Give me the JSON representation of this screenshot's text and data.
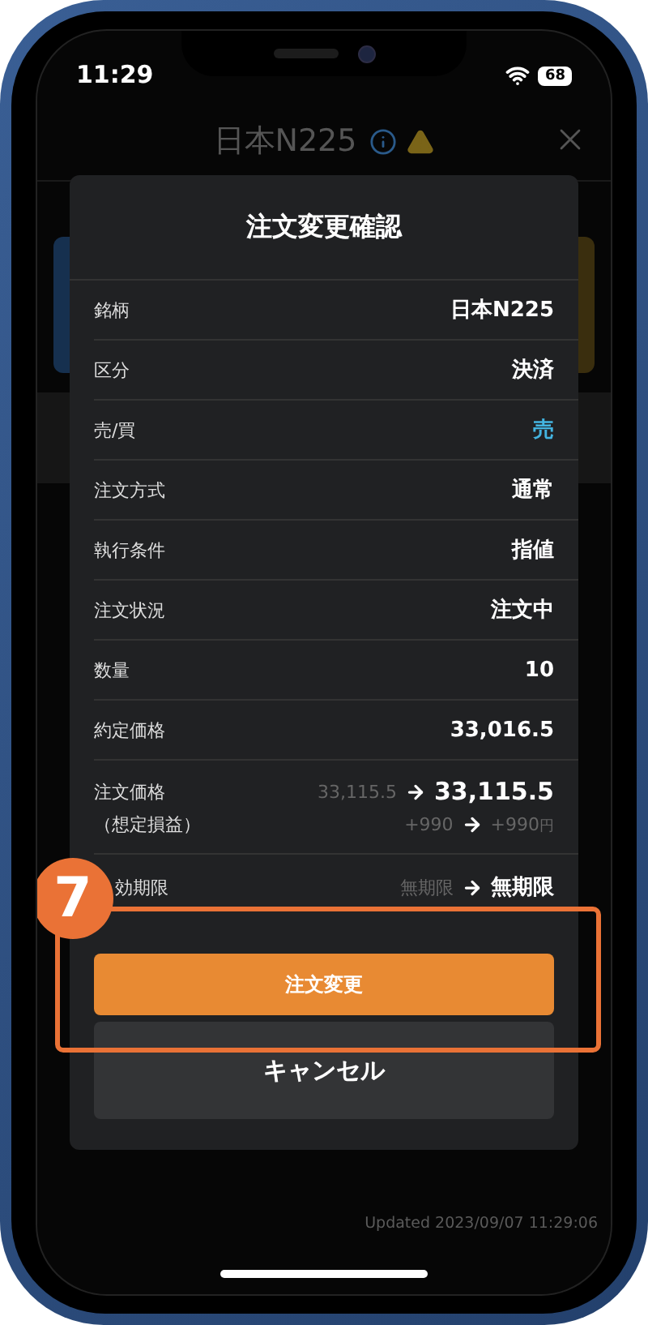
{
  "status_bar": {
    "time": "11:29",
    "battery": "68"
  },
  "header": {
    "title": "日本N225"
  },
  "dialog": {
    "title": "注文変更確認",
    "rows": [
      {
        "kind": "plain",
        "label": "銘柄",
        "value": "日本N225"
      },
      {
        "kind": "plain",
        "label": "区分",
        "value": "決済"
      },
      {
        "kind": "side",
        "label": "売/買",
        "value": "売"
      },
      {
        "kind": "plain",
        "label": "注文方式",
        "value": "通常"
      },
      {
        "kind": "plain",
        "label": "執行条件",
        "value": "指値"
      },
      {
        "kind": "plain",
        "label": "注文状況",
        "value": "注文中"
      },
      {
        "kind": "plain",
        "label": "数量",
        "value": "10"
      },
      {
        "kind": "plain",
        "label": "約定価格",
        "value": "33,016.5"
      },
      {
        "kind": "change_pair",
        "label": "注文価格",
        "sublabel": "（想定損益）",
        "old": "33,115.5",
        "new": "33,115.5",
        "old_sub": "+990",
        "new_sub": "+990",
        "unit": "円"
      },
      {
        "kind": "change",
        "label": "効期限",
        "old": "無期限",
        "new": "無期限"
      }
    ],
    "confirm_button": "注文変更",
    "cancel_button": "キャンセル"
  },
  "callout": {
    "number": "7"
  },
  "updated": "Updated 2023/09/07 11:29:06"
}
